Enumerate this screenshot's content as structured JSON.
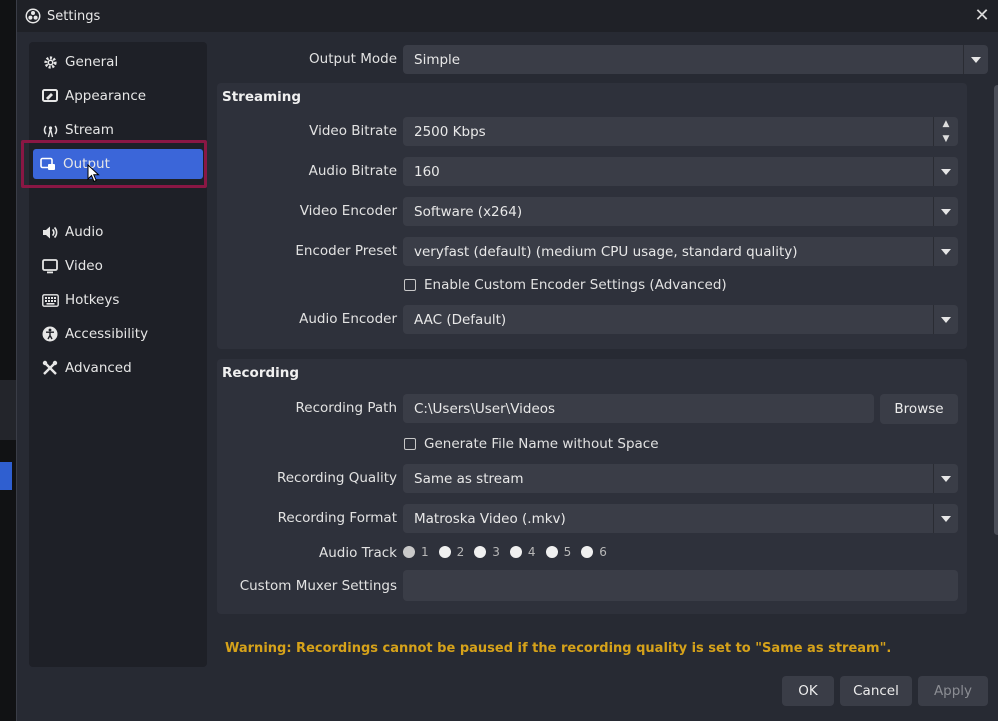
{
  "window": {
    "title": "Settings",
    "close_glyph": "✕"
  },
  "sidebar": {
    "items": [
      {
        "label": "General",
        "icon": "gear-icon"
      },
      {
        "label": "Appearance",
        "icon": "appearance-icon"
      },
      {
        "label": "Stream",
        "icon": "antenna-icon"
      },
      {
        "label": "Output",
        "icon": "output-icon",
        "selected": true
      },
      {
        "label": "Audio",
        "icon": "speaker-icon"
      },
      {
        "label": "Video",
        "icon": "monitor-icon"
      },
      {
        "label": "Hotkeys",
        "icon": "keyboard-icon"
      },
      {
        "label": "Accessibility",
        "icon": "accessibility-icon"
      },
      {
        "label": "Advanced",
        "icon": "tools-icon"
      }
    ]
  },
  "output_mode": {
    "label": "Output Mode",
    "value": "Simple"
  },
  "streaming": {
    "title": "Streaming",
    "video_bitrate": {
      "label": "Video Bitrate",
      "value": "2500 Kbps"
    },
    "audio_bitrate": {
      "label": "Audio Bitrate",
      "value": "160"
    },
    "video_encoder": {
      "label": "Video Encoder",
      "value": "Software (x264)"
    },
    "encoder_preset": {
      "label": "Encoder Preset",
      "value": "veryfast (default) (medium CPU usage, standard quality)"
    },
    "custom_encoder_checkbox": {
      "label": "Enable Custom Encoder Settings (Advanced)",
      "checked": false
    },
    "audio_encoder": {
      "label": "Audio Encoder",
      "value": "AAC (Default)"
    }
  },
  "recording": {
    "title": "Recording",
    "path": {
      "label": "Recording Path",
      "value": "C:\\Users\\User\\Videos"
    },
    "browse_label": "Browse",
    "filename_checkbox": {
      "label": "Generate File Name without Space",
      "checked": false
    },
    "quality": {
      "label": "Recording Quality",
      "value": "Same as stream"
    },
    "format": {
      "label": "Recording Format",
      "value": "Matroska Video (.mkv)"
    },
    "audio_track": {
      "label": "Audio Track",
      "tracks": [
        "1",
        "2",
        "3",
        "4",
        "5",
        "6"
      ],
      "selected": "1"
    },
    "custom_muxer": {
      "label": "Custom Muxer Settings",
      "value": ""
    }
  },
  "warning": "Warning: Recordings cannot be paused if the recording quality is set to \"Same as stream\".",
  "buttons": {
    "ok": "OK",
    "cancel": "Cancel",
    "apply": "Apply"
  },
  "colors": {
    "accent": "#3b66d9",
    "highlight_annotation": "#8a1744",
    "warning": "#d6a21a"
  }
}
